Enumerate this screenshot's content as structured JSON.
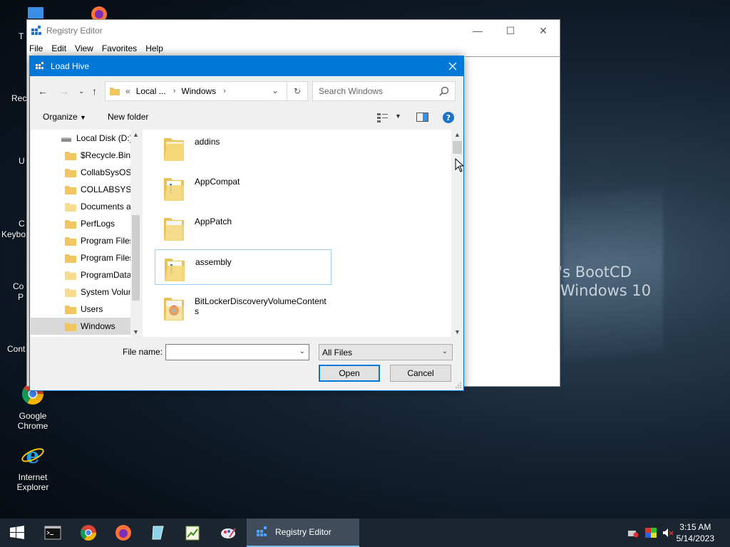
{
  "desktop": {
    "partial_labels": [
      "T",
      "Rec",
      "U",
      "C",
      "Keybo",
      "Co",
      "P",
      "Cont"
    ],
    "icons": [
      {
        "label": "Google Chrome"
      },
      {
        "label": "Internet Explorer"
      }
    ],
    "wallpaper": {
      "line1": "n's BootCD",
      "line2": "Windows 10"
    }
  },
  "registry": {
    "title": "Registry Editor",
    "menu": [
      "File",
      "Edit",
      "View",
      "Favorites",
      "Help"
    ]
  },
  "dialog": {
    "title": "Load Hive",
    "address": {
      "overflow": "«",
      "segments": [
        "Local ...",
        "Windows"
      ]
    },
    "search_placeholder": "Search Windows",
    "toolbar": {
      "organize": "Organize",
      "new_folder": "New folder"
    },
    "tree": [
      {
        "label": "Local Disk (D:)",
        "type": "drive"
      },
      {
        "label": "$Recycle.Bin"
      },
      {
        "label": "CollabSysOS"
      },
      {
        "label": "COLLABSYSOS"
      },
      {
        "label": "Documents a"
      },
      {
        "label": "PerfLogs"
      },
      {
        "label": "Program Files"
      },
      {
        "label": "Program Files"
      },
      {
        "label": "ProgramData"
      },
      {
        "label": "System Volum"
      },
      {
        "label": "Users"
      },
      {
        "label": "Windows",
        "selected": true
      }
    ],
    "files": [
      {
        "name": "addins"
      },
      {
        "name": "AppCompat"
      },
      {
        "name": "AppPatch"
      },
      {
        "name": "assembly",
        "focused": true
      },
      {
        "name": "BitLockerDiscoveryVolumeContents"
      }
    ],
    "file_name_label": "File name:",
    "file_name_value": "",
    "file_type": "All Files",
    "open_label": "Open",
    "cancel_label": "Cancel"
  },
  "taskbar": {
    "active_app": "Registry Editor",
    "time": "3:15 AM",
    "date": "5/14/2023"
  },
  "colors": {
    "accent": "#0078d7",
    "folder": "#f0c75e",
    "taskbar": "#1a2530"
  }
}
